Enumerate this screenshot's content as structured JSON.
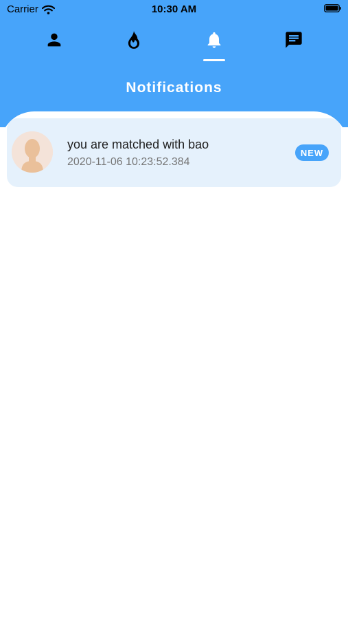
{
  "status_bar": {
    "carrier": "Carrier",
    "time": "10:30 AM"
  },
  "tabs": [
    {
      "icon": "person-icon",
      "active": false
    },
    {
      "icon": "flame-icon",
      "active": false
    },
    {
      "icon": "bell-icon",
      "active": true
    },
    {
      "icon": "chat-icon",
      "active": false
    }
  ],
  "header": {
    "title": "Notifications"
  },
  "notifications": [
    {
      "message": "you are matched with bao",
      "timestamp": "2020-11-06 10:23:52.384",
      "badge": "NEW"
    }
  ],
  "colors": {
    "header_bg": "#47a4fa",
    "card_bg": "#e5f1fc",
    "badge_bg": "#47a4fa"
  }
}
